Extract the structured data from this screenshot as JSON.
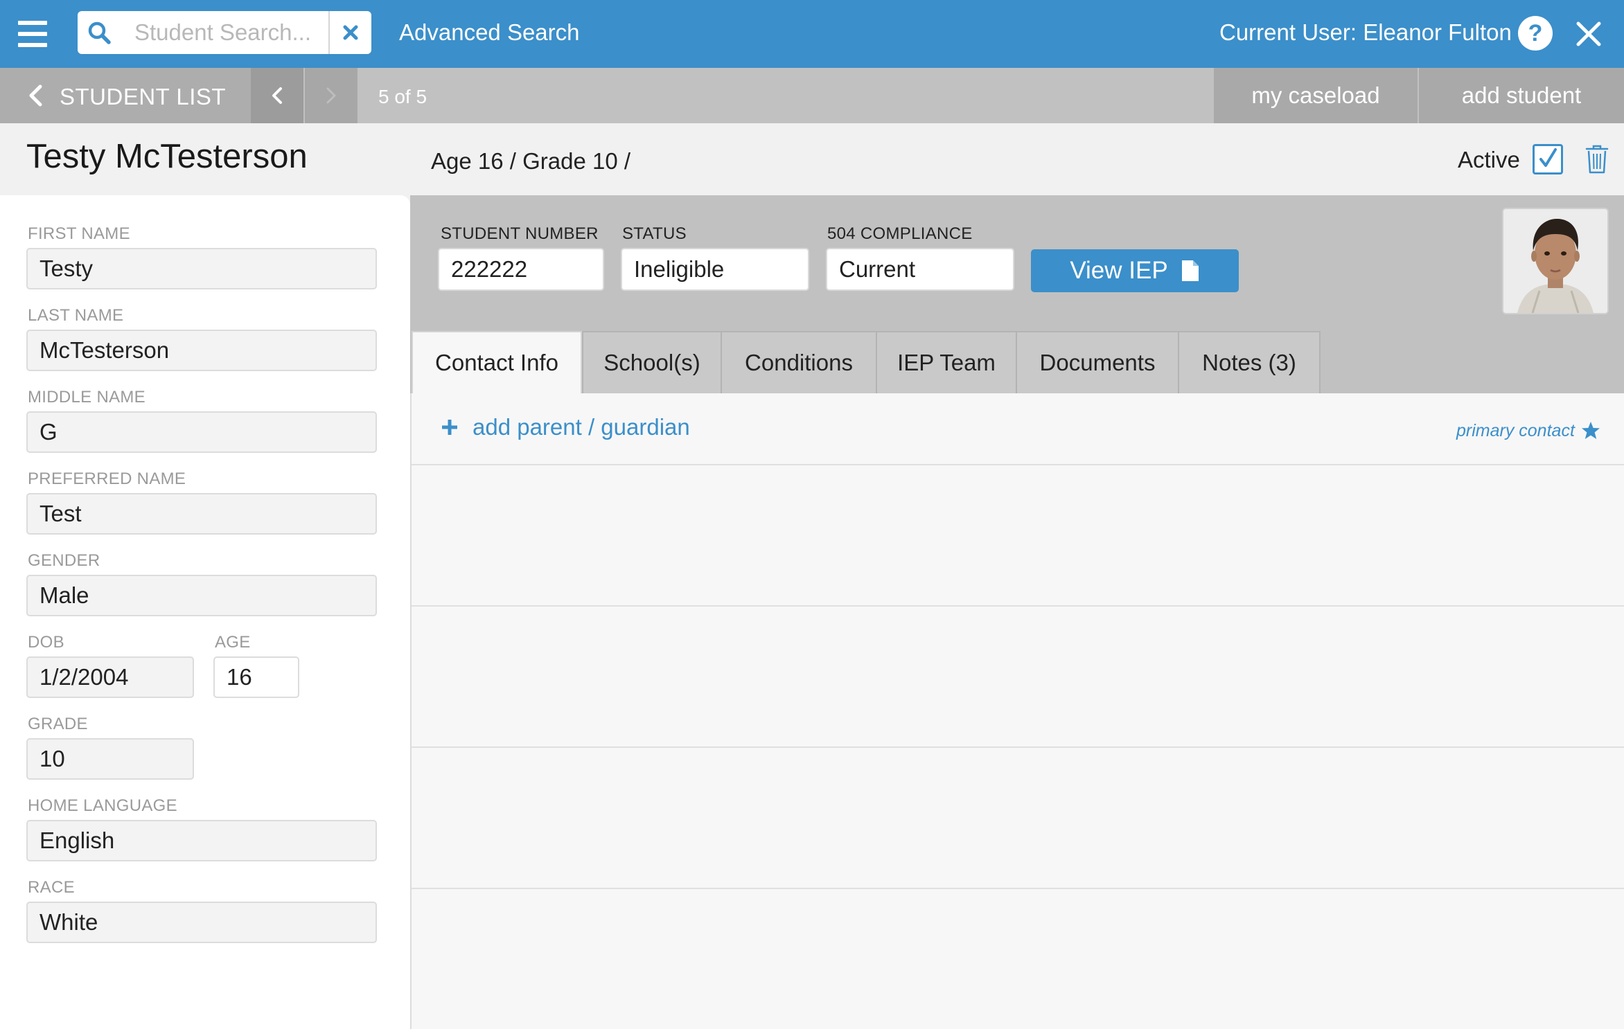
{
  "topbar": {
    "search_placeholder": "Student Search...",
    "advanced_search": "Advanced Search",
    "current_user": "Current User: Eleanor Fulton"
  },
  "nav": {
    "student_list": "STUDENT LIST",
    "pager": "5 of 5",
    "my_caseload": "my caseload",
    "add_student": "add student"
  },
  "student": {
    "full_name": "Testy McTesterson",
    "age_grade": "Age 16  /  Grade 10  /",
    "active_label": "Active",
    "active_checked": true
  },
  "fields": {
    "first_name": {
      "label": "FIRST NAME",
      "value": "Testy"
    },
    "last_name": {
      "label": "LAST NAME",
      "value": "McTesterson"
    },
    "middle_name": {
      "label": "MIDDLE NAME",
      "value": "G"
    },
    "preferred_name": {
      "label": "PREFERRED NAME",
      "value": "Test"
    },
    "gender": {
      "label": "GENDER",
      "value": "Male"
    },
    "dob": {
      "label": "DOB",
      "value": "1/2/2004"
    },
    "age": {
      "label": "AGE",
      "value": "16"
    },
    "grade": {
      "label": "GRADE",
      "value": "10"
    },
    "home_language": {
      "label": "HOME LANGUAGE",
      "value": "English"
    },
    "race": {
      "label": "RACE",
      "value": "White"
    }
  },
  "info": {
    "student_number": {
      "label": "STUDENT NUMBER",
      "value": "222222"
    },
    "status": {
      "label": "STATUS",
      "value": "Ineligible"
    },
    "compliance": {
      "label": "504 COMPLIANCE",
      "value": "Current"
    },
    "view_iep": "View IEP"
  },
  "tabs": [
    {
      "label": "Contact Info",
      "active": true
    },
    {
      "label": "School(s)"
    },
    {
      "label": "Conditions"
    },
    {
      "label": "IEP Team"
    },
    {
      "label": "Documents"
    },
    {
      "label": "Notes  (3)"
    }
  ],
  "contact": {
    "add_guardian": "add parent / guardian",
    "primary_contact": "primary contact"
  },
  "colors": {
    "brand_blue": "#3b8fca",
    "nav_gray": "#c1c1c1"
  },
  "icons": [
    "menu-icon",
    "search-icon",
    "clear-icon",
    "help-icon",
    "close-icon",
    "chevron-left-icon",
    "chevron-right-icon",
    "checkbox-icon",
    "trash-icon",
    "document-icon",
    "plus-icon",
    "star-icon"
  ]
}
